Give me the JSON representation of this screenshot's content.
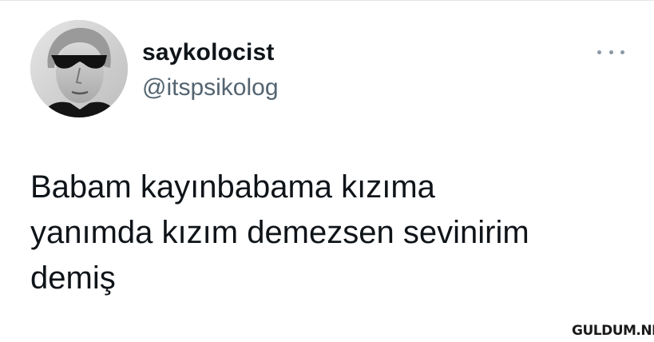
{
  "tweet": {
    "author": {
      "display_name": "saykolocist",
      "handle": "@itspsikolog"
    },
    "text": "Babam kayınbabama kızıma\nyanımda kızım demezsen sevinirim\ndemiş"
  },
  "menu": {
    "icon": "more-horizontal-icon"
  },
  "watermark": {
    "text": "GULDUM.NET"
  }
}
